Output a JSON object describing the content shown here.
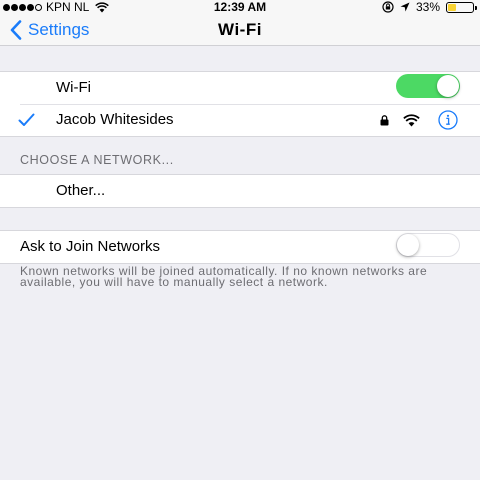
{
  "status_bar": {
    "signal_filled": 4,
    "signal_total": 5,
    "carrier": "KPN NL",
    "time": "12:39 AM",
    "battery_text": "33%",
    "battery_level": 0.33,
    "battery_color": "#f8d232",
    "icons": [
      "wifi-icon",
      "lock-rotation-icon",
      "location-arrow-icon"
    ]
  },
  "nav": {
    "back_label": "Settings",
    "title": "Wi-Fi",
    "accent_color": "#1a7cfa"
  },
  "wifi_group": {
    "wifi_label": "Wi-Fi",
    "wifi_enabled": true,
    "connected_network": "Jacob Whitesides",
    "connected_icons": [
      "lock-icon",
      "wifi-signal-icon",
      "info-icon"
    ]
  },
  "choose_section": {
    "header": "CHOOSE A NETWORK...",
    "other_label": "Other..."
  },
  "ask_group": {
    "label": "Ask to Join Networks",
    "enabled": false,
    "footer": "Known networks will be joined automatically. If no known networks are available, you will have to manually select a network."
  },
  "colors": {
    "toggle_on": "#4cd964",
    "background": "#efeff4"
  }
}
